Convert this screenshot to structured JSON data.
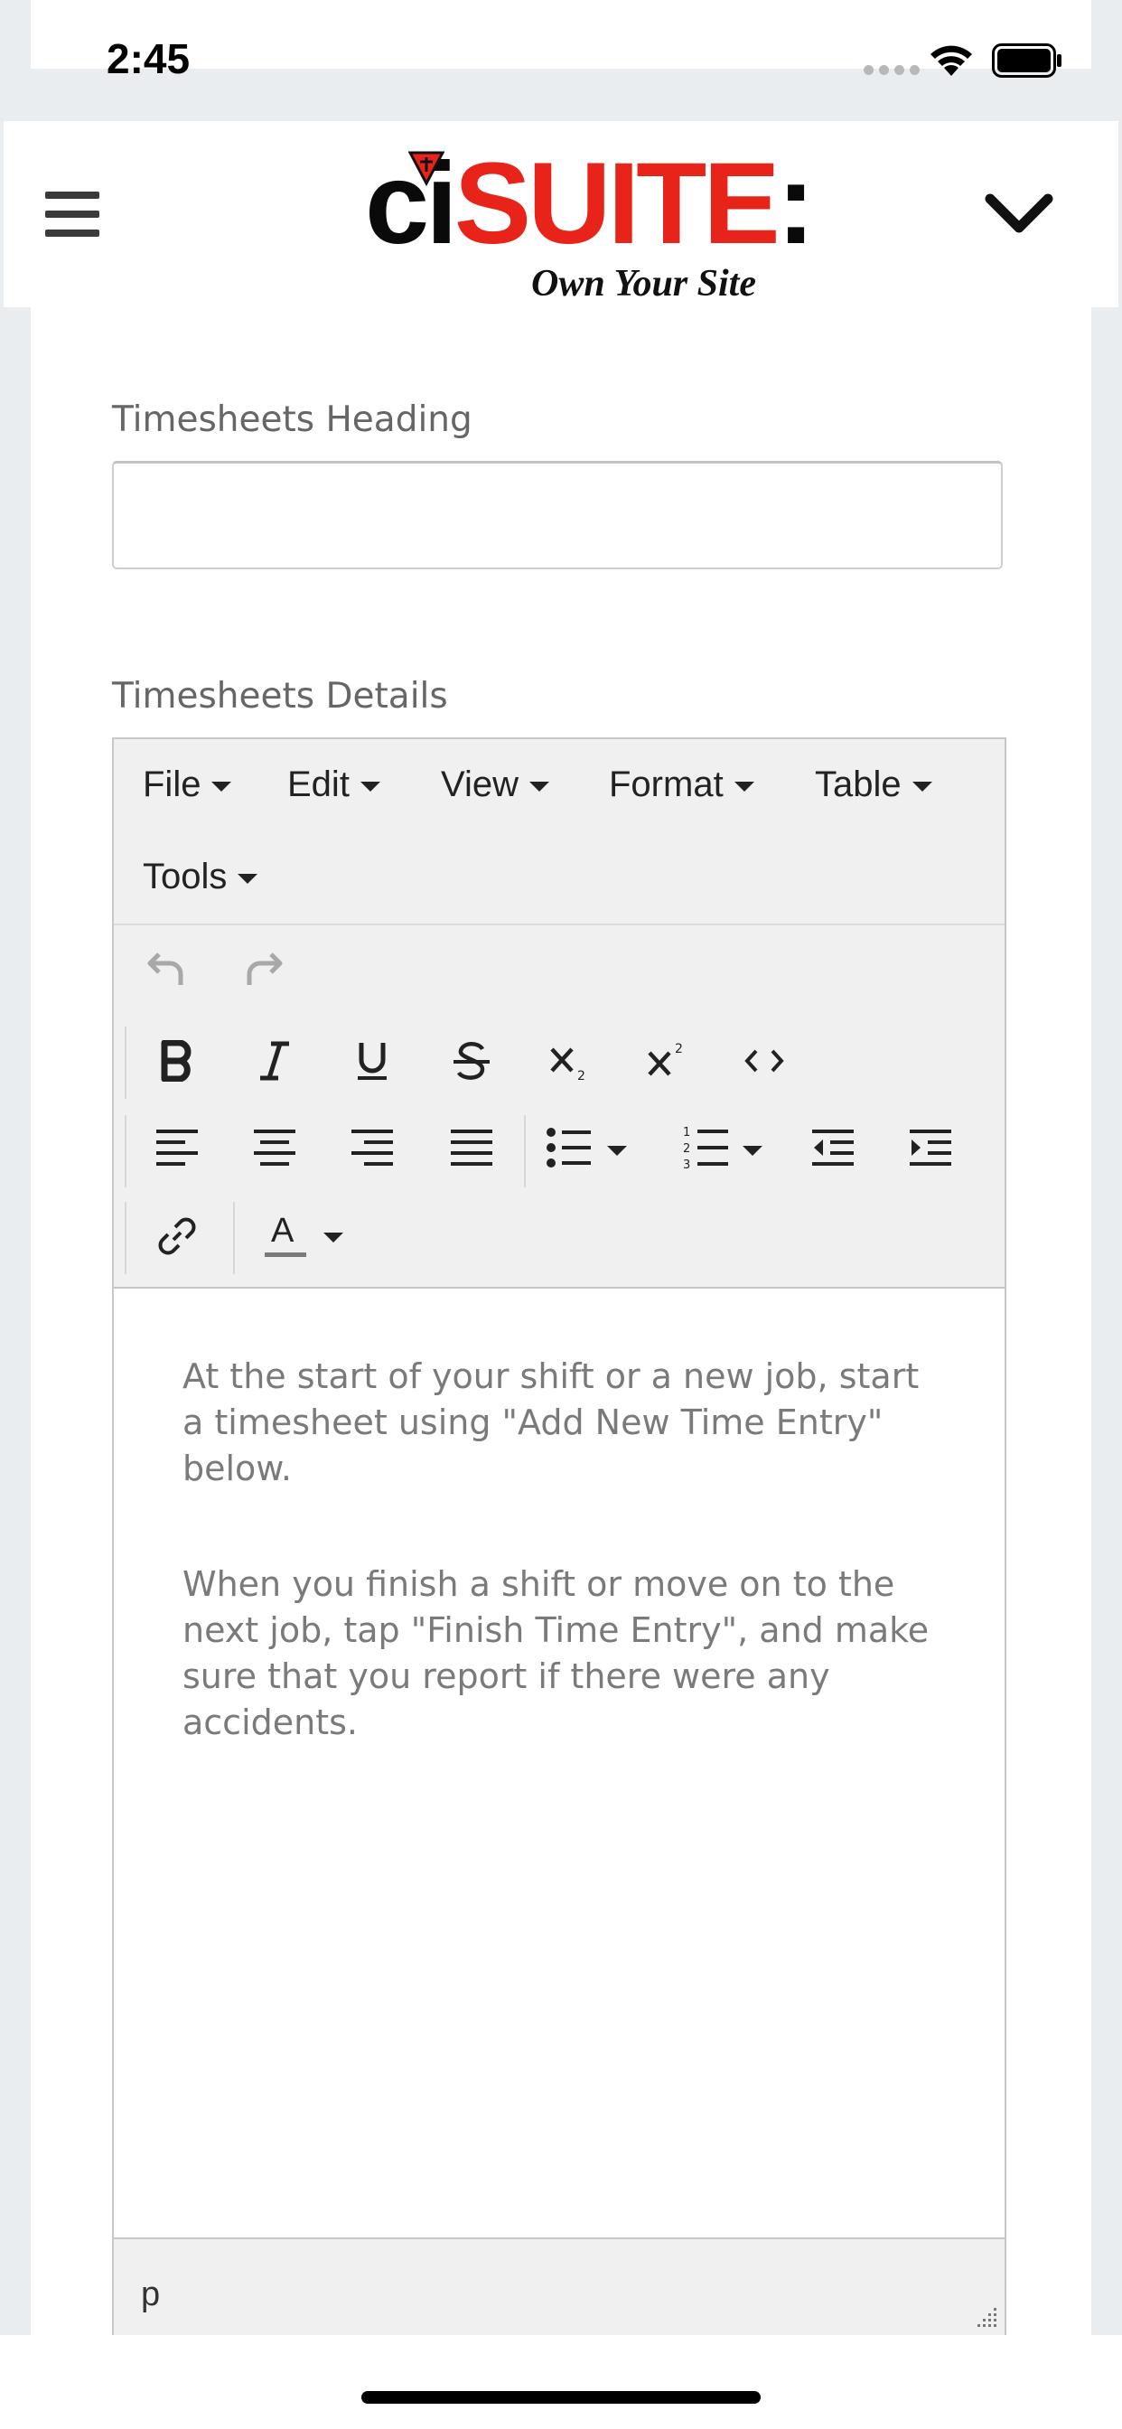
{
  "status_bar": {
    "time": "2:45"
  },
  "header": {
    "logo": {
      "part1": "ci",
      "part2": "SUITE",
      "part3": ":",
      "tagline": "Own Your Site"
    }
  },
  "form": {
    "heading_label": "Timesheets Heading",
    "heading_value": "",
    "details_label": "Timesheets Details"
  },
  "editor": {
    "menubar": [
      "File",
      "Edit",
      "View",
      "Format",
      "Table",
      "Tools"
    ],
    "content": [
      " At the start of your shift or a new job, start a timesheet using \"Add New Time Entry\" below.",
      "When you finish a shift or move on to the next job, tap \"Finish Time Entry\", and make sure that you report if there were any accidents."
    ],
    "path": "p"
  },
  "colors": {
    "brand_red": "#e8231a",
    "text_gray": "#7a7a7a",
    "toolbar_bg": "#f0f0f0"
  }
}
